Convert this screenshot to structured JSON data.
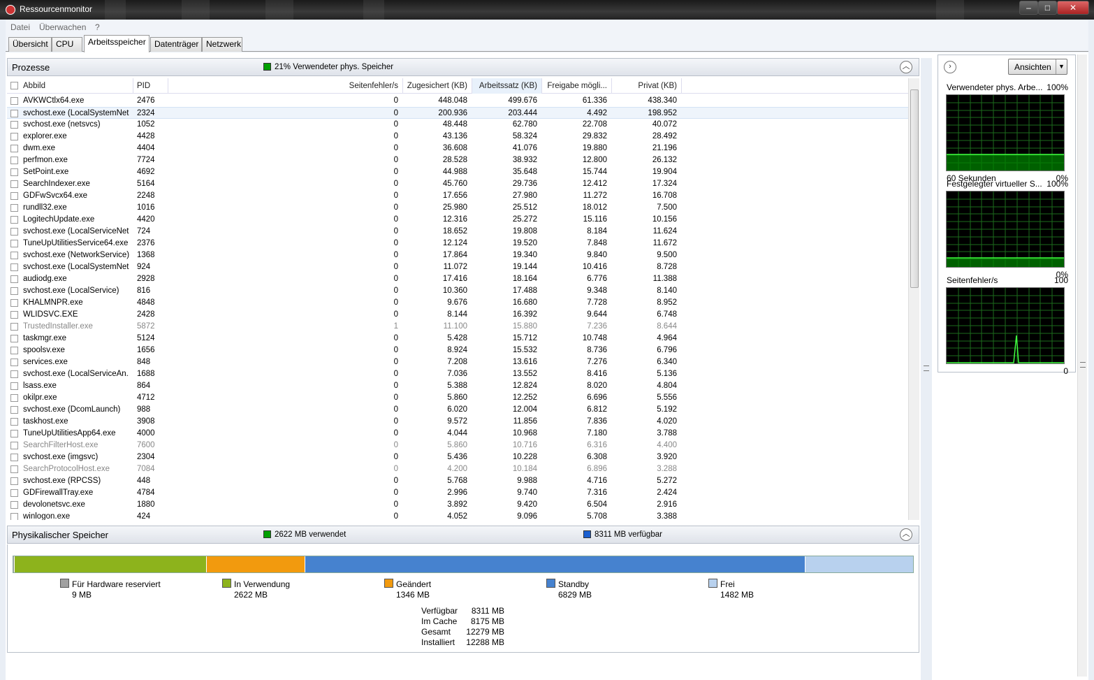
{
  "window": {
    "title": "Ressourcenmonitor"
  },
  "menu": [
    "Datei",
    "Überwachen",
    "?"
  ],
  "tabs": [
    "Übersicht",
    "CPU",
    "Arbeitsspeicher",
    "Datenträger",
    "Netzwerk"
  ],
  "active_tab": "Arbeitsspeicher",
  "processes": {
    "title": "Prozesse",
    "summary": "21% Verwendeter phys. Speicher",
    "columns": [
      "Abbild",
      "PID",
      "Seitenfehler/s",
      "Zugesichert (KB)",
      "Arbeitssatz (KB)",
      "Freigabe mögli...",
      "Privat (KB)"
    ],
    "rows": [
      [
        "AVKWCtlx64.exe",
        "2476",
        "0",
        "448.048",
        "499.676",
        "61.336",
        "438.340"
      ],
      [
        "svchost.exe (LocalSystemNet...",
        "2324",
        "0",
        "200.936",
        "203.444",
        "4.492",
        "198.952"
      ],
      [
        "svchost.exe (netsvcs)",
        "1052",
        "0",
        "48.448",
        "62.780",
        "22.708",
        "40.072"
      ],
      [
        "explorer.exe",
        "4428",
        "0",
        "43.136",
        "58.324",
        "29.832",
        "28.492"
      ],
      [
        "dwm.exe",
        "4404",
        "0",
        "36.608",
        "41.076",
        "19.880",
        "21.196"
      ],
      [
        "perfmon.exe",
        "7724",
        "0",
        "28.528",
        "38.932",
        "12.800",
        "26.132"
      ],
      [
        "SetPoint.exe",
        "4692",
        "0",
        "44.988",
        "35.648",
        "15.744",
        "19.904"
      ],
      [
        "SearchIndexer.exe",
        "5164",
        "0",
        "45.760",
        "29.736",
        "12.412",
        "17.324"
      ],
      [
        "GDFwSvcx64.exe",
        "2248",
        "0",
        "17.656",
        "27.980",
        "11.272",
        "16.708"
      ],
      [
        "rundll32.exe",
        "1016",
        "0",
        "25.980",
        "25.512",
        "18.012",
        "7.500"
      ],
      [
        "LogitechUpdate.exe",
        "4420",
        "0",
        "12.316",
        "25.272",
        "15.116",
        "10.156"
      ],
      [
        "svchost.exe (LocalServiceNet...",
        "724",
        "0",
        "18.652",
        "19.808",
        "8.184",
        "11.624"
      ],
      [
        "TuneUpUtilitiesService64.exe",
        "2376",
        "0",
        "12.124",
        "19.520",
        "7.848",
        "11.672"
      ],
      [
        "svchost.exe (NetworkService)",
        "1368",
        "0",
        "17.864",
        "19.340",
        "9.840",
        "9.500"
      ],
      [
        "svchost.exe (LocalSystemNet...",
        "924",
        "0",
        "11.072",
        "19.144",
        "10.416",
        "8.728"
      ],
      [
        "audiodg.exe",
        "2928",
        "0",
        "17.416",
        "18.164",
        "6.776",
        "11.388"
      ],
      [
        "svchost.exe (LocalService)",
        "816",
        "0",
        "10.360",
        "17.488",
        "9.348",
        "8.140"
      ],
      [
        "KHALMNPR.exe",
        "4848",
        "0",
        "9.676",
        "16.680",
        "7.728",
        "8.952"
      ],
      [
        "WLIDSVC.EXE",
        "2428",
        "0",
        "8.144",
        "16.392",
        "9.644",
        "6.748"
      ],
      [
        "TrustedInstaller.exe",
        "5872",
        "1",
        "11.100",
        "15.880",
        "7.236",
        "8.644"
      ],
      [
        "taskmgr.exe",
        "5124",
        "0",
        "5.428",
        "15.712",
        "10.748",
        "4.964"
      ],
      [
        "spoolsv.exe",
        "1656",
        "0",
        "8.924",
        "15.532",
        "8.736",
        "6.796"
      ],
      [
        "services.exe",
        "848",
        "0",
        "7.208",
        "13.616",
        "7.276",
        "6.340"
      ],
      [
        "svchost.exe (LocalServiceAn...",
        "1688",
        "0",
        "7.036",
        "13.552",
        "8.416",
        "5.136"
      ],
      [
        "lsass.exe",
        "864",
        "0",
        "5.388",
        "12.824",
        "8.020",
        "4.804"
      ],
      [
        "okilpr.exe",
        "4712",
        "0",
        "5.860",
        "12.252",
        "6.696",
        "5.556"
      ],
      [
        "svchost.exe (DcomLaunch)",
        "988",
        "0",
        "6.020",
        "12.004",
        "6.812",
        "5.192"
      ],
      [
        "taskhost.exe",
        "3908",
        "0",
        "9.572",
        "11.856",
        "7.836",
        "4.020"
      ],
      [
        "TuneUpUtilitiesApp64.exe",
        "4000",
        "0",
        "4.044",
        "10.968",
        "7.180",
        "3.788"
      ],
      [
        "SearchFilterHost.exe",
        "7600",
        "0",
        "5.860",
        "10.716",
        "6.316",
        "4.400"
      ],
      [
        "svchost.exe (imgsvc)",
        "2304",
        "0",
        "5.436",
        "10.228",
        "6.308",
        "3.920"
      ],
      [
        "SearchProtocolHost.exe",
        "7084",
        "0",
        "4.200",
        "10.184",
        "6.896",
        "3.288"
      ],
      [
        "svchost.exe (RPCSS)",
        "448",
        "0",
        "5.768",
        "9.988",
        "4.716",
        "5.272"
      ],
      [
        "GDFirewallTray.exe",
        "4784",
        "0",
        "2.996",
        "9.740",
        "7.316",
        "2.424"
      ],
      [
        "devolonetsvc.exe",
        "1880",
        "0",
        "3.892",
        "9.420",
        "6.504",
        "2.916"
      ],
      [
        "winlogon.exe",
        "424",
        "0",
        "4.052",
        "9.096",
        "5.708",
        "3.388"
      ]
    ],
    "gray_rows": [
      19,
      29,
      31
    ],
    "selected_row": 1
  },
  "physical": {
    "title": "Physikalischer Speicher",
    "used_text": "2622 MB verwendet",
    "available_text": "8311 MB verfügbar",
    "bar": [
      {
        "name": "Für Hardware reserviert",
        "value": "9 MB",
        "mb": 9,
        "color": "#a0a0a0"
      },
      {
        "name": "In Verwendung",
        "value": "2622 MB",
        "mb": 2622,
        "color": "#8db31c"
      },
      {
        "name": "Geändert",
        "value": "1346 MB",
        "mb": 1346,
        "color": "#f29a0e"
      },
      {
        "name": "Standby",
        "value": "6829 MB",
        "mb": 6829,
        "color": "#4682cf"
      },
      {
        "name": "Frei",
        "value": "1482 MB",
        "mb": 1482,
        "color": "#b8d1ee"
      }
    ],
    "stats": [
      {
        "label": "Verfügbar",
        "value": "8311 MB"
      },
      {
        "label": "Im Cache",
        "value": "8175 MB"
      },
      {
        "label": "Gesamt",
        "value": "12279 MB"
      },
      {
        "label": "Installiert",
        "value": "12288 MB"
      }
    ]
  },
  "right": {
    "views_label": "Ansichten",
    "graphs": [
      {
        "title": "Verwendeter phys. Arbe...",
        "max": "100%",
        "bottom_left": "60 Sekunden",
        "bottom_right": "0%",
        "level": 0.21
      },
      {
        "title": "Festgelegter virtueller S...",
        "max": "100%",
        "bottom_left": "",
        "bottom_right": "0%",
        "level": 0.12
      },
      {
        "title": "Seitenfehler/s",
        "max": "100",
        "bottom_left": "",
        "bottom_right": "0",
        "level": 0.0
      }
    ]
  },
  "colors": {
    "used_green": "#00a000",
    "standby_blue": "#1a5fd0",
    "graph_bg": "#000000",
    "graph_grid": "#1c6b1c"
  }
}
